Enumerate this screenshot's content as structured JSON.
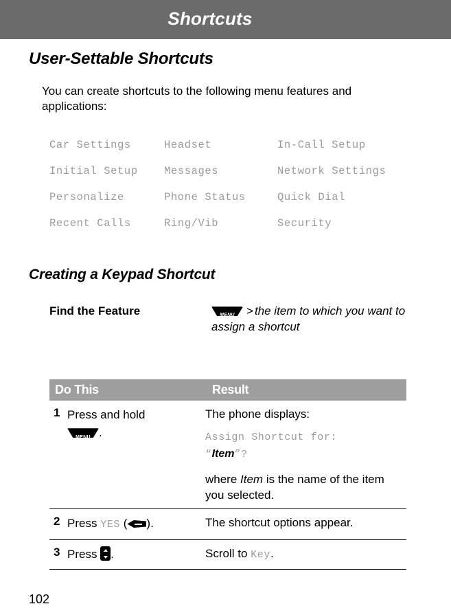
{
  "header": {
    "title": "Shortcuts"
  },
  "sections": {
    "user_settable": {
      "heading": "User-Settable Shortcuts",
      "intro": "You can create shortcuts to the following menu features and applications:",
      "features": [
        [
          "Car Settings",
          "Headset",
          "In-Call Setup"
        ],
        [
          "Initial Setup",
          "Messages",
          "Network Settings"
        ],
        [
          "Personalize",
          "Phone Status",
          "Quick Dial"
        ],
        [
          "Recent Calls",
          "Ring/Vib",
          "Security"
        ]
      ]
    },
    "creating_keypad_shortcut": {
      "heading": "Creating a Keypad Shortcut",
      "find_the_feature": {
        "label": "Find the Feature",
        "key_icon": "menu-key-icon",
        "separator": ">",
        "path": "the item to which you want to assign a shortcut"
      },
      "table": {
        "columns": [
          "Do This",
          "Result"
        ],
        "rows": [
          {
            "num": "1",
            "do_prefix": "Press and hold",
            "do_key_icon": "menu-key-icon",
            "do_suffix": ".",
            "result_intro": "The phone displays:",
            "result_display_line1": "Assign Shortcut for:",
            "result_display_quote_open": "“",
            "result_display_item": "Item",
            "result_display_quote_close": "”?",
            "result_note_pre": "where ",
            "result_note_em": "Item",
            "result_note_post": " is the name of the item you selected."
          },
          {
            "num": "2",
            "do_prefix": "Press ",
            "do_code": "YES",
            "do_key_icon": "soft-key-icon",
            "do_suffix": ".",
            "result": "The shortcut options appear."
          },
          {
            "num": "3",
            "do_prefix": "Press ",
            "do_key_icon": "scroll-key-icon",
            "do_suffix": ".",
            "result_pre": "Scroll to ",
            "result_code": "Key",
            "result_post": "."
          }
        ]
      }
    }
  },
  "footer": {
    "page_number": "102"
  }
}
